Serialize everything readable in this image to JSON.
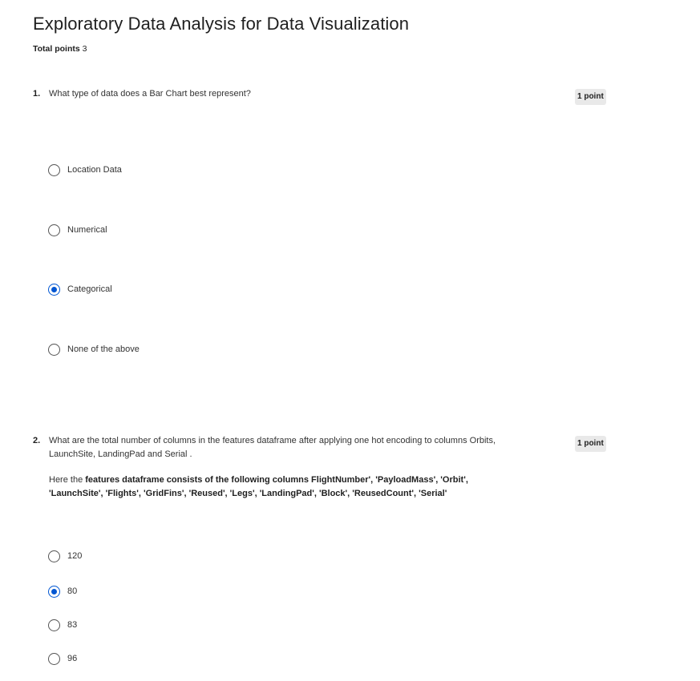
{
  "quiz": {
    "title": "Exploratory Data Analysis for Data Visualization",
    "total_points_label": "Total points",
    "total_points_value": "3"
  },
  "questions": [
    {
      "number": "1.",
      "text": "What type of data does a Bar Chart best represent?",
      "points": "1 point",
      "options": [
        {
          "label": "Location Data",
          "selected": false
        },
        {
          "label": "Numerical",
          "selected": false
        },
        {
          "label": "Categorical",
          "selected": true
        },
        {
          "label": "None of the above",
          "selected": false
        }
      ]
    },
    {
      "number": "2.",
      "text_line1": "What are the total number of columns in the features dataframe after applying one hot encoding to columns Orbits,",
      "text_line2": "LaunchSite, LandingPad and Serial .",
      "detail_prefix": "Here the",
      "detail_bold_line1": "features  dataframe consists of the following columns FlightNumber', 'PayloadMass', 'Orbit',",
      "detail_bold_line2": "'LaunchSite', 'Flights', 'GridFins', 'Reused', 'Legs', 'LandingPad', 'Block', 'ReusedCount', 'Serial'",
      "points": "1 point",
      "options": [
        {
          "label": "120",
          "selected": false
        },
        {
          "label": "80",
          "selected": true
        },
        {
          "label": "83",
          "selected": false
        },
        {
          "label": "96",
          "selected": false
        }
      ]
    }
  ],
  "colors": {
    "accent": "#0056d2",
    "badge_bg": "#e9e9e9",
    "text": "#1f1f1f"
  }
}
